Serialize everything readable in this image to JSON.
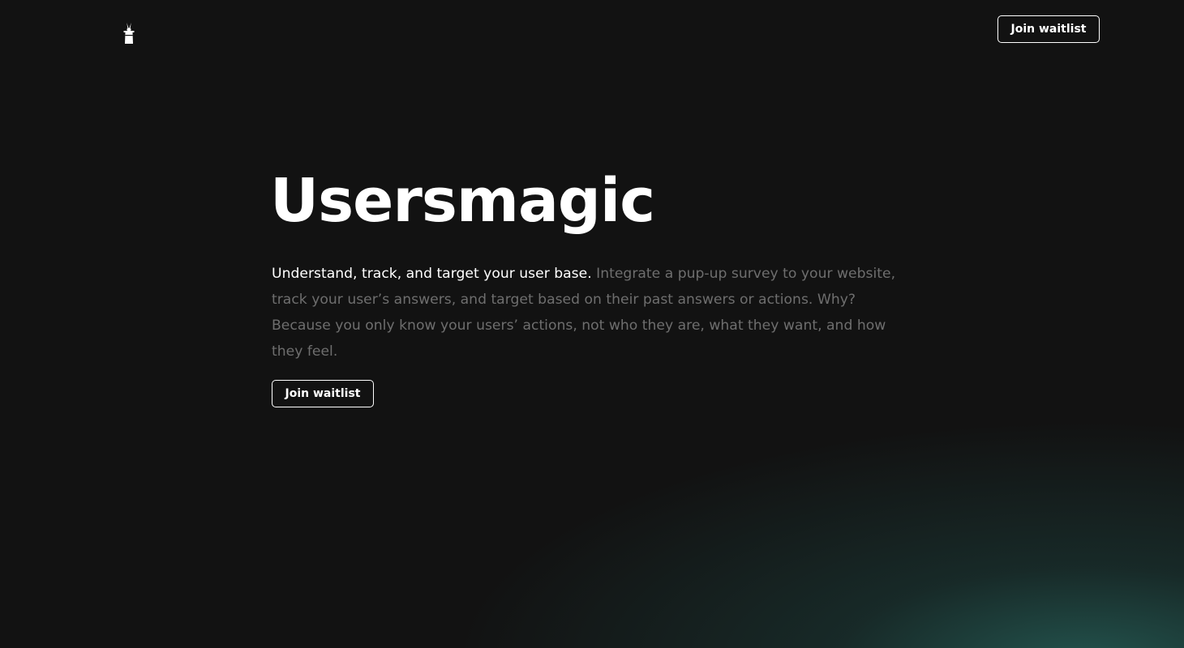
{
  "brand": {
    "logo_icon": "magic-hat-rabbit-icon"
  },
  "nav": {
    "cta_label": "Join waitlist"
  },
  "hero": {
    "title": "Usersmagic",
    "lead": "Understand, track, and target your user base.",
    "body": " Integrate a pup-up survey to your website, track your user’s answers, and target based on their past answers or actions. Why? Because you only know your users’ actions, not who they are, what they want, and how they feel.",
    "cta_label": "Join waitlist"
  },
  "colors": {
    "background": "#121212",
    "text_primary": "#ffffff",
    "text_muted": "#6e6e6e",
    "glow": "#265f58"
  }
}
